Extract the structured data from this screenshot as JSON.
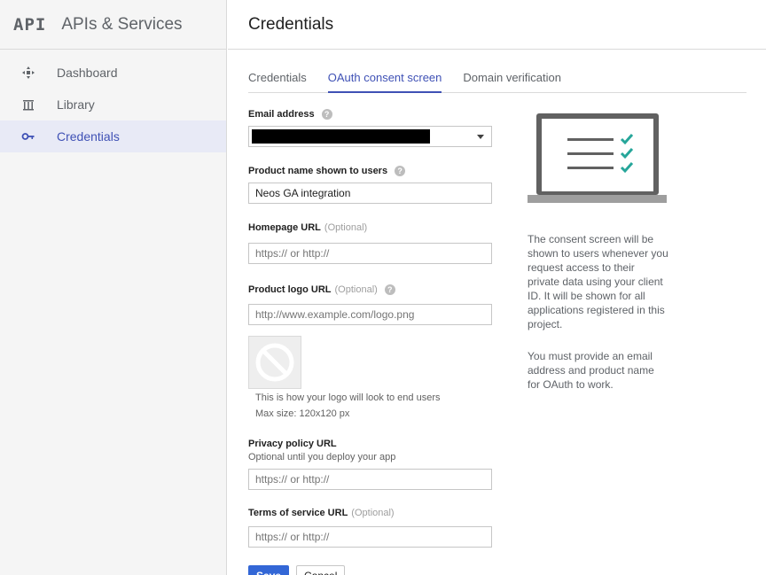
{
  "sidebar": {
    "logo": "API",
    "title": "APIs & Services",
    "items": [
      {
        "label": "Dashboard",
        "icon": "dashboard-icon",
        "active": false
      },
      {
        "label": "Library",
        "icon": "library-icon",
        "active": false
      },
      {
        "label": "Credentials",
        "icon": "key-icon",
        "active": true
      }
    ]
  },
  "header": {
    "title": "Credentials"
  },
  "tabs": [
    {
      "label": "Credentials",
      "active": false
    },
    {
      "label": "OAuth consent screen",
      "active": true
    },
    {
      "label": "Domain verification",
      "active": false
    }
  ],
  "form": {
    "email": {
      "label": "Email address",
      "value": ""
    },
    "product_name": {
      "label": "Product name shown to users",
      "value": "Neos GA integration"
    },
    "homepage": {
      "label": "Homepage URL",
      "optional": "(Optional)",
      "placeholder": "https:// or http://"
    },
    "logo_url": {
      "label": "Product logo URL",
      "optional": "(Optional)",
      "placeholder": "http://www.example.com/logo.png"
    },
    "logo_preview": {
      "note1": "This is how your logo will look to end users",
      "note2": "Max size: 120x120 px"
    },
    "privacy": {
      "label": "Privacy policy URL",
      "sublabel": "Optional until you deploy your app",
      "placeholder": "https:// or http://"
    },
    "terms": {
      "label": "Terms of service URL",
      "optional": "(Optional)",
      "placeholder": "https:// or http://"
    },
    "save_label": "Save",
    "cancel_label": "Cancel"
  },
  "info": {
    "para1": "The consent screen will be shown to users whenever you request access to their private data using your client ID. It will be shown for all applications registered in this project.",
    "para2": "You must provide an email address and product name for OAuth to work."
  },
  "colors": {
    "accent": "#3f51b5",
    "primary_button": "#3367d6",
    "check": "#26a69a"
  }
}
